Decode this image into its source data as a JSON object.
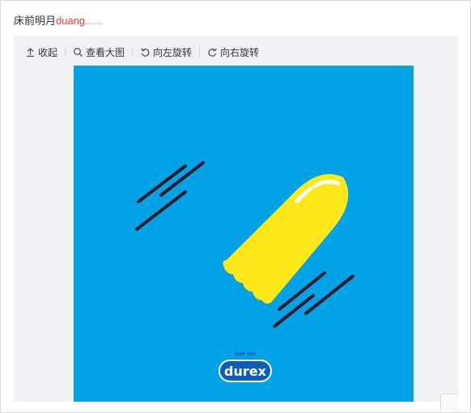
{
  "post": {
    "text_prefix": "床前明月",
    "text_highlight": "duang",
    "text_suffix": "......"
  },
  "toolbar": {
    "collapse_label": "收起",
    "view_large_label": "查看大图",
    "rotate_left_label": "向左旋转",
    "rotate_right_label": "向右旋转"
  },
  "image": {
    "tagline": "love sex",
    "brand": "durex",
    "colors": {
      "background": "#02a3e6",
      "shape": "#ffe81a",
      "highlight": "#ffffff",
      "lines": "#1a1a2e"
    }
  }
}
